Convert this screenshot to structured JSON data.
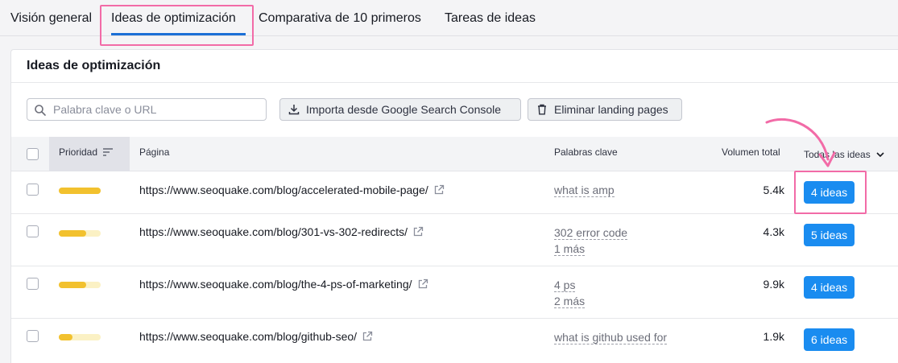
{
  "tabs": [
    {
      "label": "Visión general"
    },
    {
      "label": "Ideas de optimización",
      "active": true
    },
    {
      "label": "Comparativa de 10 primeros"
    },
    {
      "label": "Tareas de ideas"
    }
  ],
  "card": {
    "title": "Ideas de optimización"
  },
  "toolbar": {
    "search_placeholder": "Palabra clave o URL",
    "import_label": "Importa desde Google Search Console",
    "delete_label": "Eliminar landing pages"
  },
  "table": {
    "headers": {
      "priority": "Prioridad",
      "page": "Página",
      "keywords": "Palabras clave",
      "volume": "Volumen total",
      "ideas_filter": "Todas las ideas"
    },
    "rows": [
      {
        "priority": 1.0,
        "url": "https://www.seoquake.com/blog/accelerated-mobile-page/",
        "keyword": "what is amp",
        "more": "",
        "volume": "5.4k",
        "ideas": "4 ideas"
      },
      {
        "priority": 0.66,
        "url": "https://www.seoquake.com/blog/301-vs-302-redirects/",
        "keyword": "302 error code",
        "more": "1 más",
        "volume": "4.3k",
        "ideas": "5 ideas"
      },
      {
        "priority": 0.66,
        "url": "https://www.seoquake.com/blog/the-4-ps-of-marketing/",
        "keyword": "4 ps",
        "more": "2 más",
        "volume": "9.9k",
        "ideas": "4 ideas"
      },
      {
        "priority": 0.33,
        "url": "https://www.seoquake.com/blog/github-seo/",
        "keyword": "what is github used for",
        "more": "",
        "volume": "1.9k",
        "ideas": "6 ideas"
      }
    ]
  },
  "colors": {
    "accent": "#1a8cf0",
    "priority_fill": "#f2c12e",
    "priority_empty": "#fbf1c4",
    "highlight": "#f26ba7"
  },
  "icons": [
    "search-icon",
    "download-icon",
    "trash-icon",
    "sort-icon",
    "chevron-down-icon",
    "external-link-icon",
    "annotation-arrow"
  ]
}
